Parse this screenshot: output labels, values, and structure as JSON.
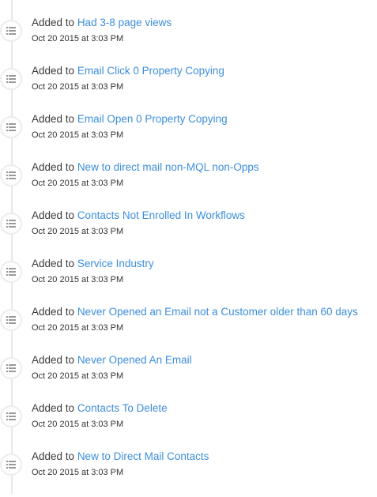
{
  "timeline": {
    "icon": "list-icon",
    "colors": {
      "text": "#3b3b3b",
      "link": "#3c8edb",
      "rail": "#e8e8e8",
      "icon": "#999999"
    },
    "events": [
      {
        "prefix": "Added to",
        "list_name": "Had 3-8 page views",
        "timestamp": "Oct 20 2015 at 3:03 PM"
      },
      {
        "prefix": "Added to",
        "list_name": "Email Click 0 Property Copying",
        "timestamp": "Oct 20 2015 at 3:03 PM"
      },
      {
        "prefix": "Added to",
        "list_name": "Email Open 0 Property Copying",
        "timestamp": "Oct 20 2015 at 3:03 PM"
      },
      {
        "prefix": "Added to",
        "list_name": "New to direct mail non-MQL non-Opps",
        "timestamp": "Oct 20 2015 at 3:03 PM"
      },
      {
        "prefix": "Added to",
        "list_name": "Contacts Not Enrolled In Workflows",
        "timestamp": "Oct 20 2015 at 3:03 PM"
      },
      {
        "prefix": "Added to",
        "list_name": "Service Industry",
        "timestamp": "Oct 20 2015 at 3:03 PM"
      },
      {
        "prefix": "Added to",
        "list_name": "Never Opened an Email not a Customer older than 60 days",
        "timestamp": "Oct 20 2015 at 3:03 PM"
      },
      {
        "prefix": "Added to",
        "list_name": "Never Opened An Email",
        "timestamp": "Oct 20 2015 at 3:03 PM"
      },
      {
        "prefix": "Added to",
        "list_name": "Contacts To Delete",
        "timestamp": "Oct 20 2015 at 3:03 PM"
      },
      {
        "prefix": "Added to",
        "list_name": "New to Direct Mail Contacts",
        "timestamp": "Oct 20 2015 at 3:03 PM"
      }
    ]
  }
}
